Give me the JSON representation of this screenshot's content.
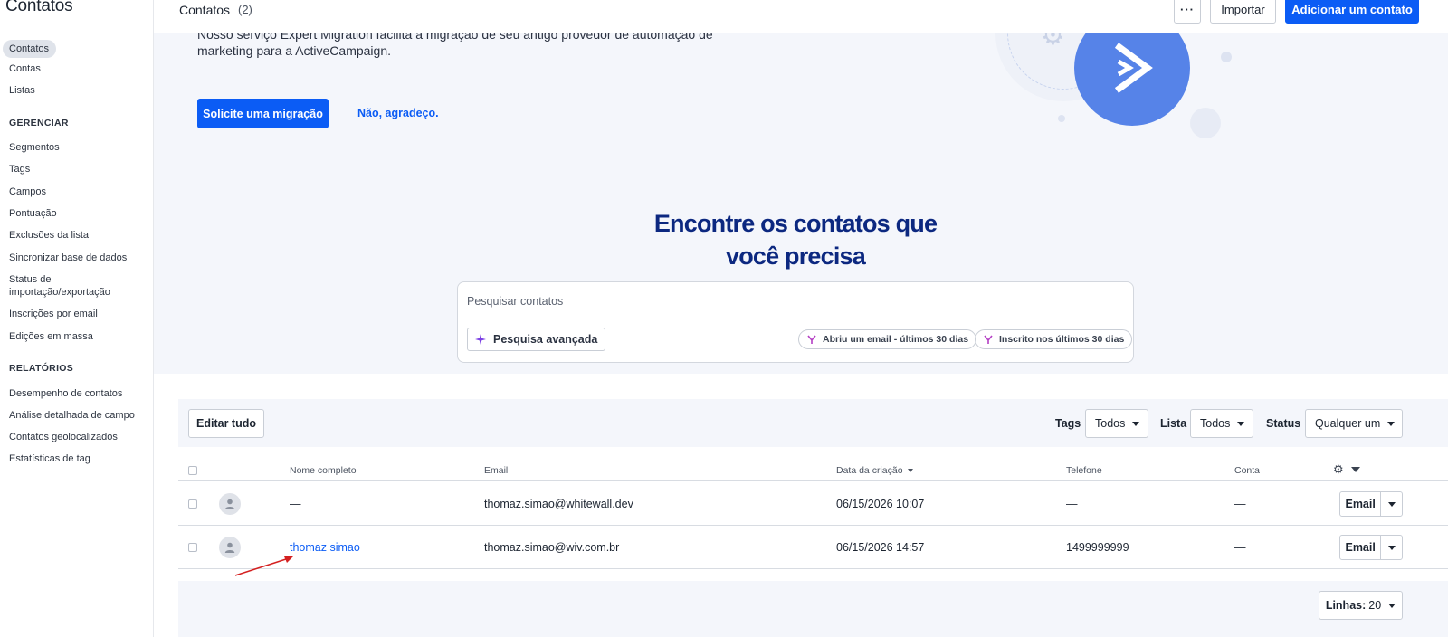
{
  "sidebar": {
    "title": "Contatos",
    "primary": [
      {
        "label": "Contatos",
        "active": true
      },
      {
        "label": "Contas"
      },
      {
        "label": "Listas"
      }
    ],
    "manage_heading": "GERENCIAR",
    "manage": [
      {
        "label": "Segmentos"
      },
      {
        "label": "Tags"
      },
      {
        "label": "Campos"
      },
      {
        "label": "Pontuação"
      },
      {
        "label": "Exclusões da lista"
      },
      {
        "label": "Sincronizar base de dados"
      },
      {
        "label": "Status de importação/exportação"
      },
      {
        "label": "Inscrições por email"
      },
      {
        "label": "Edições em massa"
      }
    ],
    "reports_heading": "RELATÓRIOS",
    "reports": [
      {
        "label": "Desempenho de contatos"
      },
      {
        "label": "Análise detalhada de campo"
      },
      {
        "label": "Contatos geolocalizados"
      },
      {
        "label": "Estatísticas de tag"
      }
    ]
  },
  "header": {
    "title": "Contatos",
    "count": "(2)",
    "more_label": "···",
    "import_label": "Importar",
    "add_label": "Adicionar um contato"
  },
  "banner": {
    "migration_text": "Nosso serviço Expert Migration facilita a migração de seu antigo provedor de automação de marketing para a ActiveCampaign.",
    "migration_button": "Solicite uma migração",
    "decline_link": "Não, agradeço.",
    "find_title_line1": "Encontre os contatos que",
    "find_title_line2": "você precisa",
    "search_placeholder": "Pesquisar contatos",
    "advanced_search": "Pesquisa avançada",
    "chips": [
      "Abriu um email - últimos 30 dias",
      "Inscrito nos últimos 30 dias"
    ],
    "accent_color": "#0b5cf5",
    "logo_circle_color": "#5683e8"
  },
  "toolbar": {
    "edit_all": "Editar tudo",
    "tags_label": "Tags",
    "tags_value": "Todos",
    "list_label": "Lista",
    "list_value": "Todos",
    "status_label": "Status",
    "status_value": "Qualquer um"
  },
  "table": {
    "columns": [
      "Nome completo",
      "Email",
      "Data da criação",
      "Telefone",
      "Conta"
    ],
    "rows": [
      {
        "name": "—",
        "email": "thomaz.simao@whitewall.dev",
        "created": "06/15/2026 10:07",
        "phone": "—",
        "account": "—",
        "action": "Email",
        "name_is_link": false
      },
      {
        "name": "thomaz simao",
        "email": "thomaz.simao@wiv.com.br",
        "created": "06/15/2026 14:57",
        "phone": "1499999999",
        "account": "—",
        "action": "Email",
        "name_is_link": true
      }
    ]
  },
  "footer": {
    "lines_label": "Linhas:",
    "lines_value": "20"
  }
}
